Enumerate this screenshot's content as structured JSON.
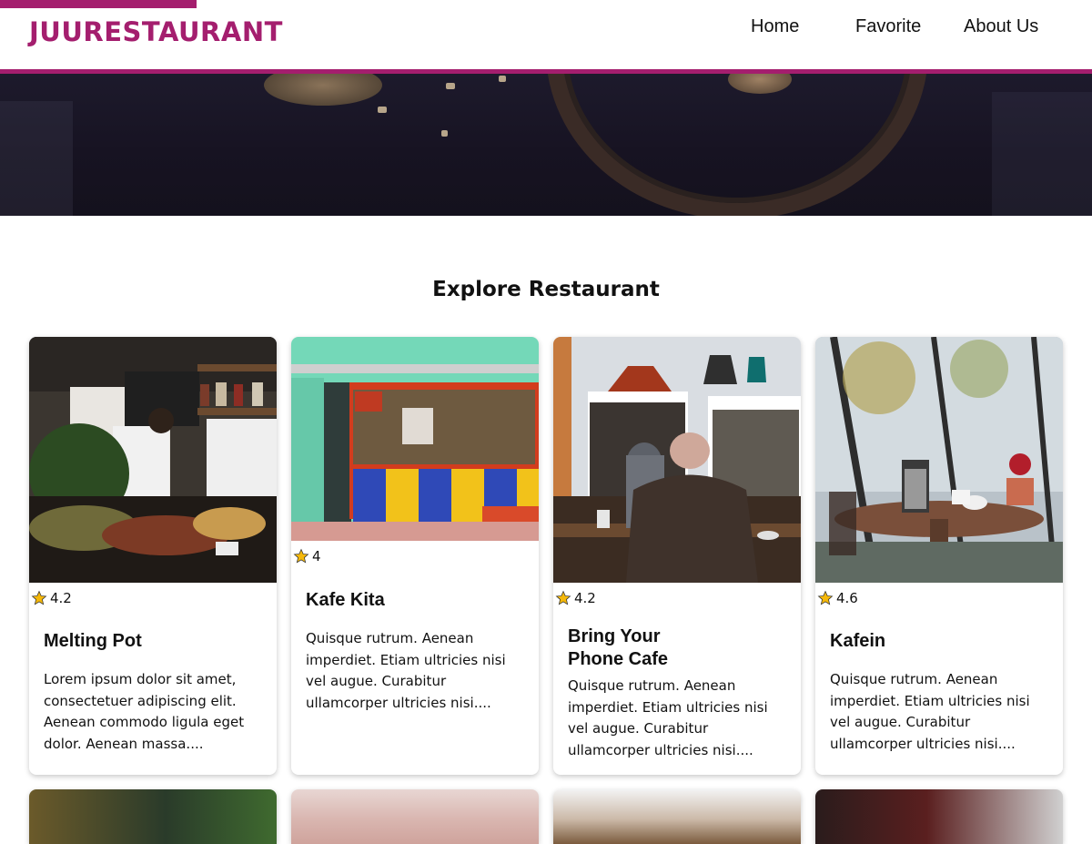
{
  "header": {
    "brand": "JUURESTAURANT",
    "nav": [
      "Home",
      "Favorite",
      "About Us"
    ],
    "accent_color": "#a41e6e"
  },
  "main": {
    "section_title": "Explore Restaurant",
    "cards": [
      {
        "rating": "4.2",
        "name": "Melting Pot",
        "description": "Lorem ipsum dolor sit amet, consectetuer adipiscing elit. Aenean commodo ligula eget dolor. Aenean massa...."
      },
      {
        "rating": "4",
        "name": "Kafe Kita",
        "description": "Quisque rutrum. Aenean imperdiet. Etiam ultricies nisi vel augue. Curabitur ullamcorper ultricies nisi...."
      },
      {
        "rating": "4.2",
        "name": "Bring Your Phone Cafe",
        "description": "Quisque rutrum. Aenean imperdiet. Etiam ultricies nisi vel augue. Curabitur ullamcorper ultricies nisi...."
      },
      {
        "rating": "4.6",
        "name": "Kafein",
        "description": "Quisque rutrum. Aenean imperdiet. Etiam ultricies nisi vel augue. Curabitur ullamcorper ultricies nisi...."
      }
    ],
    "icons": {
      "rating": "star-icon"
    }
  }
}
